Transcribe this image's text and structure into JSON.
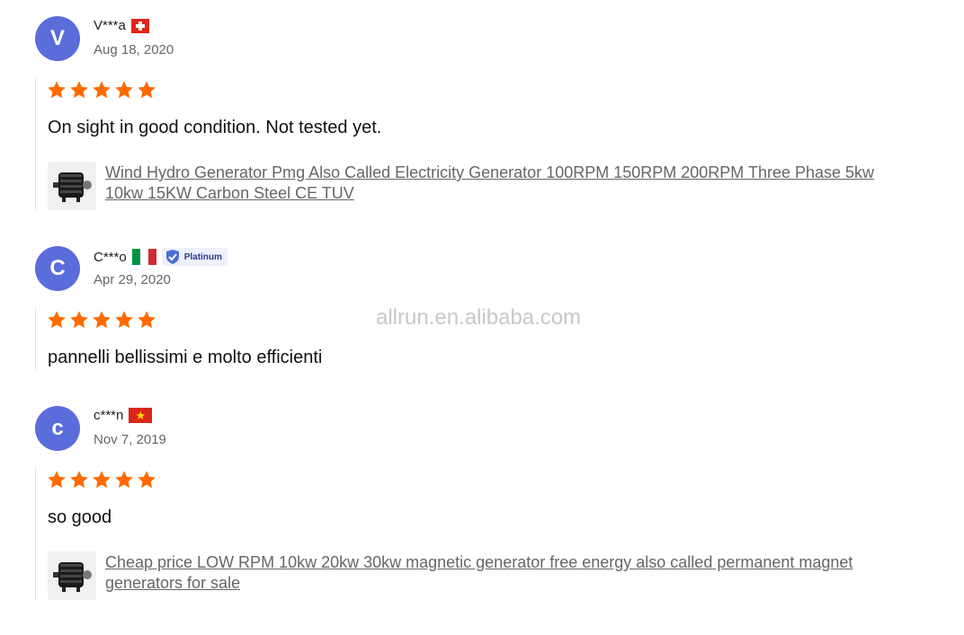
{
  "reviews": [
    {
      "avatar_letter": "V",
      "name": "V***a",
      "country_flag": "switzerland-flag",
      "date": "Aug 18, 2020",
      "rating": 5,
      "comment": "On sight in good condition. Not tested yet.",
      "product": "Wind Hydro Generator Pmg Also Called Electricity Generator 100RPM 150RPM 200RPM Three Phase 5kw 10kw 15KW Carbon Steel CE TUV"
    },
    {
      "avatar_letter": "C",
      "name": "C***o",
      "country_flag": "italy-flag",
      "badge": "Platinum",
      "date": "Apr 29, 2020",
      "rating": 5,
      "comment": "pannelli bellissimi e molto efficienti"
    },
    {
      "avatar_letter": "c",
      "name": "c***n",
      "country_flag": "vietnam-flag",
      "date": "Nov 7, 2019",
      "rating": 5,
      "comment": "so good",
      "product": "Cheap price LOW RPM 10kw 20kw 30kw magnetic generator free energy also called permanent magnet generators for sale"
    }
  ],
  "watermark": "allrun.en.alibaba.com",
  "colors": {
    "star": "#ff6a00",
    "avatar": "#5b6cdb",
    "link": "#666666"
  },
  "icons": {
    "star": "star-icon",
    "product_thumb": "generator-thumbnail"
  }
}
